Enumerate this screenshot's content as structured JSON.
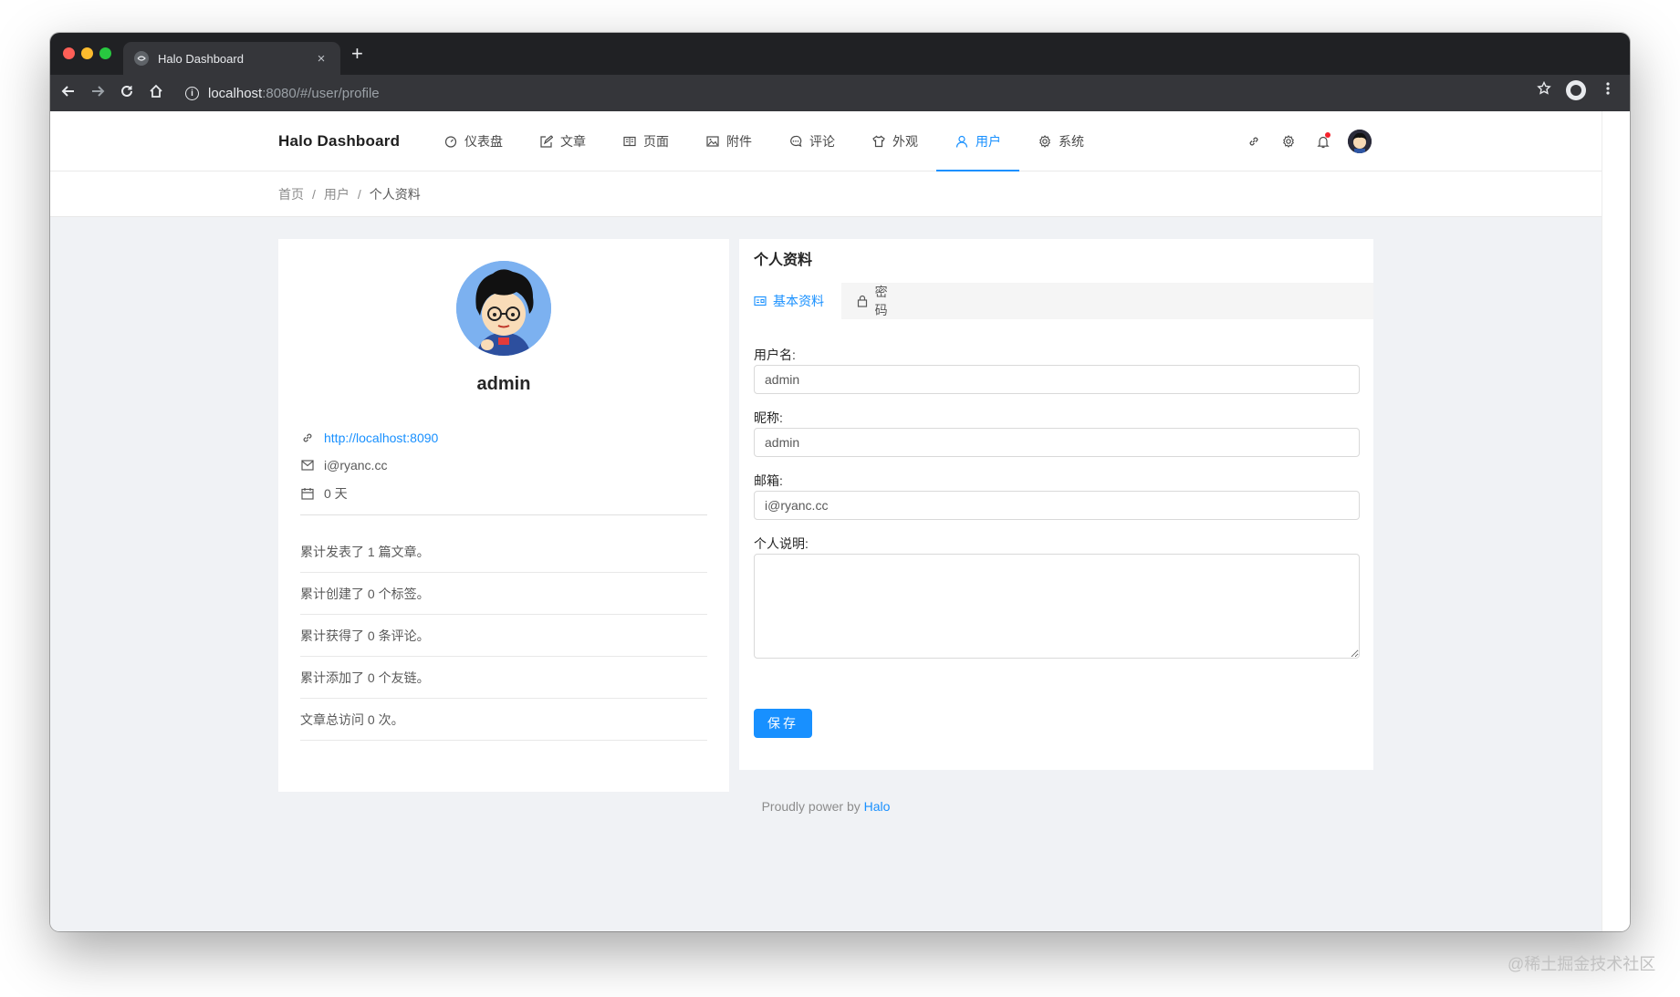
{
  "browser": {
    "tab_title": "Halo Dashboard",
    "tab_close": "×",
    "new_tab": "+",
    "url_host": "localhost",
    "url_path": ":8080/#/user/profile"
  },
  "header": {
    "brand": "Halo  Dashboard",
    "nav": [
      {
        "label": "仪表盘",
        "icon": "dashboard-icon"
      },
      {
        "label": "文章",
        "icon": "form-icon"
      },
      {
        "label": "页面",
        "icon": "read-icon"
      },
      {
        "label": "附件",
        "icon": "picture-icon"
      },
      {
        "label": "评论",
        "icon": "message-icon"
      },
      {
        "label": "外观",
        "icon": "skin-icon"
      },
      {
        "label": "用户",
        "icon": "user-icon",
        "active": true
      },
      {
        "label": "系统",
        "icon": "setting-icon"
      }
    ]
  },
  "breadcrumb": {
    "items": [
      "首页",
      "用户",
      "个人资料"
    ],
    "separator": "/"
  },
  "profile": {
    "username": "admin",
    "website": "http://localhost:8090",
    "email": "i@ryanc.cc",
    "days": "0 天",
    "stats": [
      "累计发表了 1 篇文章。",
      "累计创建了 0 个标签。",
      "累计获得了 0 条评论。",
      "累计添加了 0 个友链。",
      "文章总访问 0 次。"
    ]
  },
  "form": {
    "title": "个人资料",
    "tabs": {
      "basic": "基本资料",
      "password": "密码"
    },
    "fields": {
      "username_label": "用户名:",
      "username_value": "admin",
      "nickname_label": "昵称:",
      "nickname_value": "admin",
      "email_label": "邮箱:",
      "email_value": "i@ryanc.cc",
      "description_label": "个人说明:",
      "description_value": ""
    },
    "save_label": "保存"
  },
  "footer": {
    "text": "Proudly power by ",
    "link": "Halo"
  },
  "watermark": "@稀土掘金技术社区",
  "colors": {
    "accent": "#1890ff",
    "page_bg": "#f0f2f5",
    "browser_chrome": "#202124",
    "notification_dot": "#f5222d"
  }
}
